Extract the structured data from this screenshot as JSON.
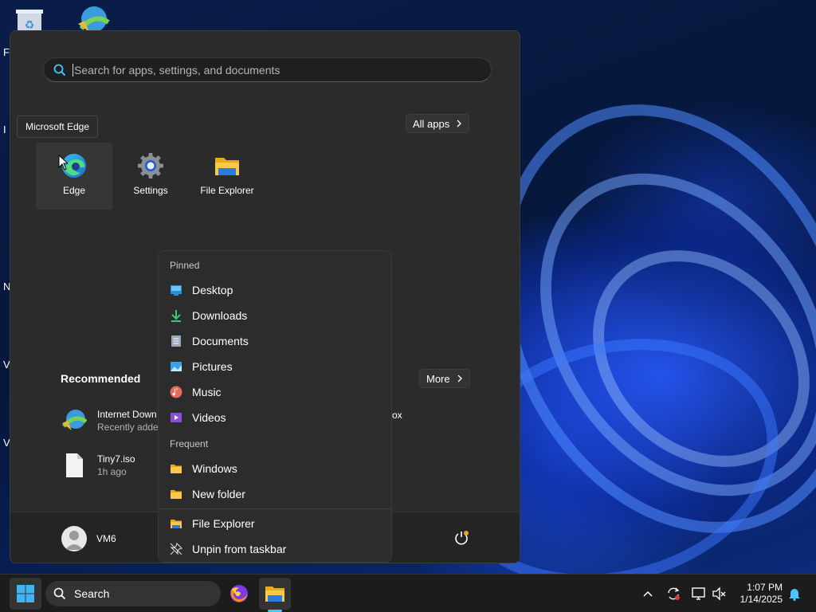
{
  "desktop": {
    "edge_label_fragments": [
      "F",
      "I",
      "N",
      "V",
      "V"
    ]
  },
  "start_menu": {
    "search_placeholder": "Search for apps, settings, and documents",
    "pinned": {
      "all_apps_label": "All apps",
      "apps": [
        {
          "label": "Edge",
          "icon": "edge-icon"
        },
        {
          "label": "Settings",
          "icon": "settings-gear-icon"
        },
        {
          "label": "File Explorer",
          "icon": "file-explorer-icon"
        }
      ]
    },
    "tooltip": "Microsoft Edge",
    "recommended": {
      "title": "Recommended",
      "more_label": "More",
      "items": [
        {
          "name": "Internet Down",
          "sub": "Recently adde",
          "icon": "internet-download-manager-icon"
        },
        {
          "name": "Tiny7.iso",
          "sub": "1h ago",
          "icon": "file-icon"
        }
      ],
      "partial_text": "ox"
    },
    "user": {
      "name": "VM6"
    }
  },
  "jump_list": {
    "pinned_header": "Pinned",
    "pinned_items": [
      {
        "label": "Desktop",
        "icon": "desktop-folder-icon"
      },
      {
        "label": "Downloads",
        "icon": "download-icon"
      },
      {
        "label": "Documents",
        "icon": "document-icon"
      },
      {
        "label": "Pictures",
        "icon": "pictures-icon"
      },
      {
        "label": "Music",
        "icon": "music-icon"
      },
      {
        "label": "Videos",
        "icon": "videos-icon"
      }
    ],
    "frequent_header": "Frequent",
    "frequent_items": [
      {
        "label": "Windows",
        "icon": "folder-icon"
      },
      {
        "label": "New folder",
        "icon": "folder-icon"
      }
    ],
    "actions": [
      {
        "label": "File Explorer",
        "icon": "file-explorer-icon"
      },
      {
        "label": "Unpin from taskbar",
        "icon": "unpin-icon"
      }
    ]
  },
  "taskbar": {
    "search_label": "Search",
    "clock": {
      "time": "1:07 PM",
      "date": "1/14/2025"
    }
  },
  "colors": {
    "accent": "#4cc2ff",
    "menu_bg": "#2b2b2b",
    "taskbar_bg": "#1c1c1c",
    "folder_yellow": "#f5c542"
  }
}
